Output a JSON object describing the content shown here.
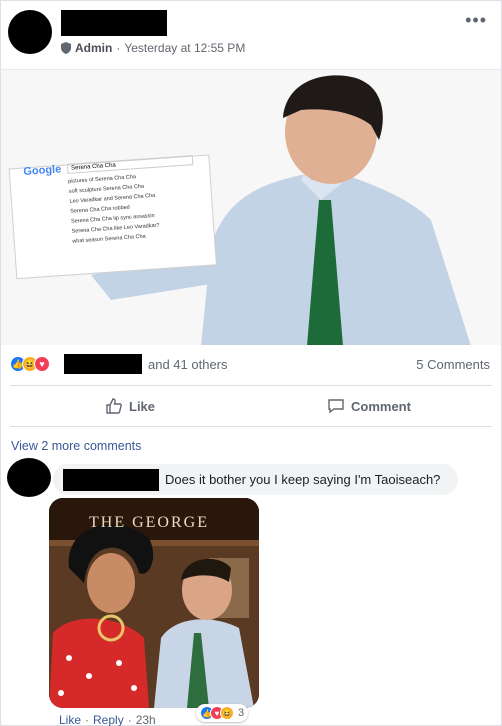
{
  "header": {
    "admin_label": "Admin",
    "timestamp": "Yesterday at 12:55 PM",
    "more_icon": "•••"
  },
  "post_image": {
    "search_logo": "Google",
    "search_query": "Serena Cha Cha",
    "suggestions": [
      "pictures of Serena Cha Cha",
      "soft sculpture Serena Cha Cha",
      "Leo Varadkar and Serena Cha Cha",
      "Serena Cha Cha robbed",
      "Serena Cha Cha lip sync assassin",
      "Serena Cha Cha like Leo Varadkar?",
      "what season Serena Cha Cha"
    ]
  },
  "reactions": {
    "others_text": "and 41 others",
    "comments_count": "5 Comments"
  },
  "actions": {
    "like_label": "Like",
    "comment_label": "Comment"
  },
  "comments": {
    "view_more": "View 2 more comments",
    "comment_text": "Does it bother you I keep saying I'm Taoiseach?",
    "image_sign": "THE GEORGE",
    "like_label": "Like",
    "reply_label": "Reply",
    "time": "23h",
    "reaction_count": "3"
  },
  "colors": {
    "link": "#385898",
    "like_blue": "#1877f2",
    "haha_yellow": "#f7b125",
    "love_red": "#f33e58"
  }
}
